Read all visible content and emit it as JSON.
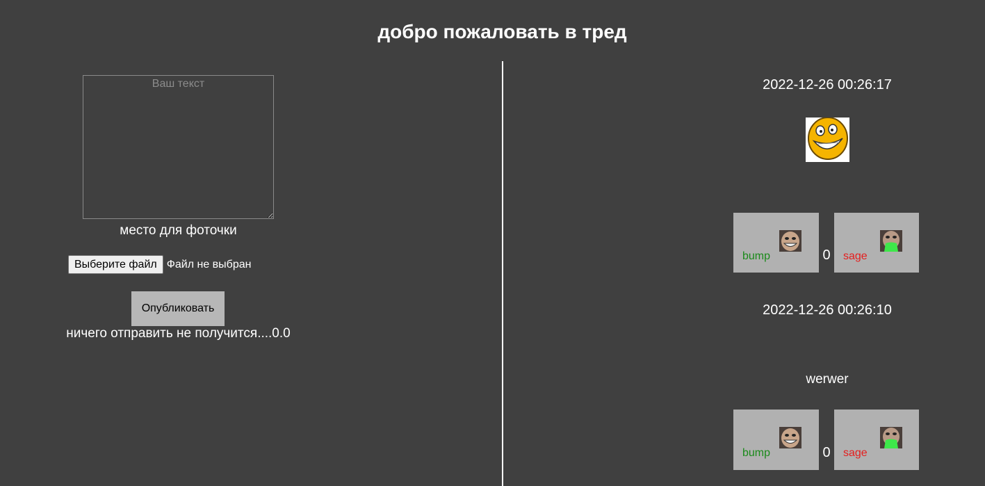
{
  "header": {
    "title": "добро пожаловать в тред"
  },
  "form": {
    "textarea_placeholder": "Ваш текст",
    "photo_label": "место для фоточки",
    "file_button_label": "Выберите файл",
    "file_status": "Файл не выбран",
    "publish_label": "Опубликовать",
    "error_text": "ничего отправить не получится....0.0"
  },
  "posts": [
    {
      "date": "2022-12-26 00:26:17",
      "image_icon": "smiling-face-icon",
      "bump_label": "bump",
      "vote_count": "0",
      "sage_label": "sage"
    },
    {
      "date": "2022-12-26 00:26:10",
      "text": "werwer",
      "bump_label": "bump",
      "vote_count": "0",
      "sage_label": "sage"
    }
  ],
  "colors": {
    "background": "#404040",
    "text": "#ffffff",
    "bump": "#1a8a1a",
    "sage": "#e51e1e",
    "vote_box": "#b1b1b1",
    "publish_button": "#b7b7b7"
  }
}
